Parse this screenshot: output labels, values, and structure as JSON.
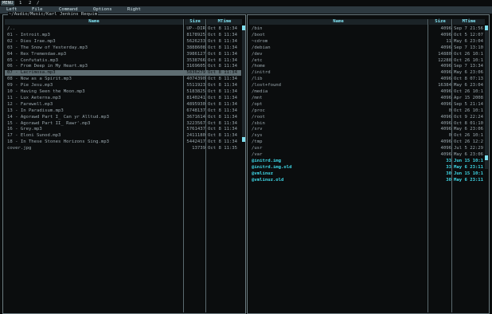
{
  "tabs": {
    "menu_label": "MENU",
    "tab1": "1",
    "tab2": "2",
    "close": "/"
  },
  "menu": {
    "left": "Left",
    "file": "File",
    "command": "Command",
    "options": "Options",
    "right": "Right"
  },
  "left_panel": {
    "path": "~/Audio/Music/Karl Jenkins Requim",
    "col_name": "Name",
    "col_size": "Size",
    "col_mtime": "MTime",
    "rows": [
      {
        "name": "/..",
        "size": "UP--DIR",
        "mtime": "Oct  8 11:34"
      },
      {
        "name": "01 - Introit.mp3",
        "size": "8178925",
        "mtime": "Oct  8 11:34"
      },
      {
        "name": "02 - Dies Irae.mp3",
        "size": "5626233",
        "mtime": "Oct  8 11:34"
      },
      {
        "name": "03 - The Snow of Yesterday.mp3",
        "size": "3888608",
        "mtime": "Oct  8 11:34"
      },
      {
        "name": "04 - Rex Tremendae.mp3",
        "size": "3986127",
        "mtime": "Oct  8 11:34"
      },
      {
        "name": "05 - Confutatis.mp3",
        "size": "3538766",
        "mtime": "Oct  8 11:34"
      },
      {
        "name": "06 - From Deep in My Heart.mp3",
        "size": "3169605",
        "mtime": "Oct  8 11:34"
      },
      {
        "name": "07 - Lacrimosa.mp3",
        "size": "5836279",
        "mtime": "Oct  8 11:34"
      },
      {
        "name": "08 - Now as a Spirit.mp3",
        "size": "4074390",
        "mtime": "Oct  8 11:34"
      },
      {
        "name": "09 - Pie Jesu.mp3",
        "size": "5511923",
        "mtime": "Oct  8 11:34"
      },
      {
        "name": "10 - Having Seen the Moon.mp3",
        "size": "5183825",
        "mtime": "Oct  8 11:34"
      },
      {
        "name": "11 - Lux Aeterna.mp3",
        "size": "8140241",
        "mtime": "Oct  8 11:34"
      },
      {
        "name": "12 - Farewell.mp3",
        "size": "4895930",
        "mtime": "Oct  8 11:34"
      },
      {
        "name": "13 - In Paradisum.mp3",
        "size": "6748137",
        "mtime": "Oct  8 11:34"
      },
      {
        "name": "14 - Agorawd Part I_ Can yr Alltud.mp3",
        "size": "3671614",
        "mtime": "Oct  8 11:34"
      },
      {
        "name": "15 - Agorawd Part II_ Rawr'.mp3",
        "size": "3223567",
        "mtime": "Oct  8 11:34"
      },
      {
        "name": "16 - Grey.mp3",
        "size": "5761437",
        "mtime": "Oct  8 11:34"
      },
      {
        "name": "17 - Eloni Sunod.mp3",
        "size": "2411180",
        "mtime": "Oct  8 11:34"
      },
      {
        "name": "18 - In These Stones Horizons Sing.mp3",
        "size": "5442417",
        "mtime": "Oct  8 11:34"
      },
      {
        "name": "cover.jpg",
        "size": "13739",
        "mtime": "Oct  8 11:35"
      }
    ],
    "selected_index": 7
  },
  "right_panel": {
    "col_name": "Name",
    "col_size": "Size",
    "col_mtime": "MTime",
    "rows": [
      {
        "name": "/bin",
        "size": "4096",
        "mtime": "Sep  7 21:56",
        "type": "dir"
      },
      {
        "name": "/boot",
        "size": "4096",
        "mtime": "Oct  5 12:07",
        "type": "dir"
      },
      {
        "name": "~cdrom",
        "size": "11",
        "mtime": "May  6 23:04",
        "type": "dir"
      },
      {
        "name": "/debian",
        "size": "4096",
        "mtime": "Sep  7 13:10",
        "type": "dir"
      },
      {
        "name": "/dev",
        "size": "14880",
        "mtime": "Oct 26 10:15",
        "type": "dir"
      },
      {
        "name": "/etc",
        "size": "12288",
        "mtime": "Oct 26 10:15",
        "type": "dir"
      },
      {
        "name": "/home",
        "size": "4096",
        "mtime": "Sep  7 13:34",
        "type": "dir"
      },
      {
        "name": "/initrd",
        "size": "4096",
        "mtime": "May  6 23:06",
        "type": "dir"
      },
      {
        "name": "/lib",
        "size": "4096",
        "mtime": "Oct  8 07:13",
        "type": "dir"
      },
      {
        "name": "/lost+found",
        "size": "16384",
        "mtime": "May  6 23:04",
        "type": "dir"
      },
      {
        "name": "/media",
        "size": "4096",
        "mtime": "Oct 26 10:15",
        "type": "dir"
      },
      {
        "name": "/mnt",
        "size": "4096",
        "mtime": "Apr 15  2008",
        "type": "dir"
      },
      {
        "name": "/opt",
        "size": "4096",
        "mtime": "Sep  5 21:14",
        "type": "dir"
      },
      {
        "name": "/proc",
        "size": "0",
        "mtime": "Oct 26 10:14",
        "type": "dir"
      },
      {
        "name": "/root",
        "size": "4096",
        "mtime": "Oct  9 22:24",
        "type": "dir"
      },
      {
        "name": "/sbin",
        "size": "4096",
        "mtime": "Oct  8 01:10",
        "type": "dir"
      },
      {
        "name": "/srv",
        "size": "4096",
        "mtime": "May  6 23:06",
        "type": "dir"
      },
      {
        "name": "/sys",
        "size": "0",
        "mtime": "Oct 26 10:14",
        "type": "dir"
      },
      {
        "name": "/tmp",
        "size": "4096",
        "mtime": "Oct 26 12:20",
        "type": "dir"
      },
      {
        "name": "/usr",
        "size": "4096",
        "mtime": "Jul  5 22:29",
        "type": "dir"
      },
      {
        "name": "/var",
        "size": "4096",
        "mtime": "May  6 23:06",
        "type": "dir"
      },
      {
        "name": "@initrd.img",
        "size": "33",
        "mtime": "Jun 15 10:12",
        "type": "link"
      },
      {
        "name": "@initrd.img.old",
        "size": "33",
        "mtime": "May  6 23:11",
        "type": "link"
      },
      {
        "name": "@vmlinuz",
        "size": "30",
        "mtime": "Jun 15 10:12",
        "type": "link"
      },
      {
        "name": "@vmlinuz.old",
        "size": "30",
        "mtime": "May  6 23:11",
        "type": "link"
      }
    ]
  }
}
